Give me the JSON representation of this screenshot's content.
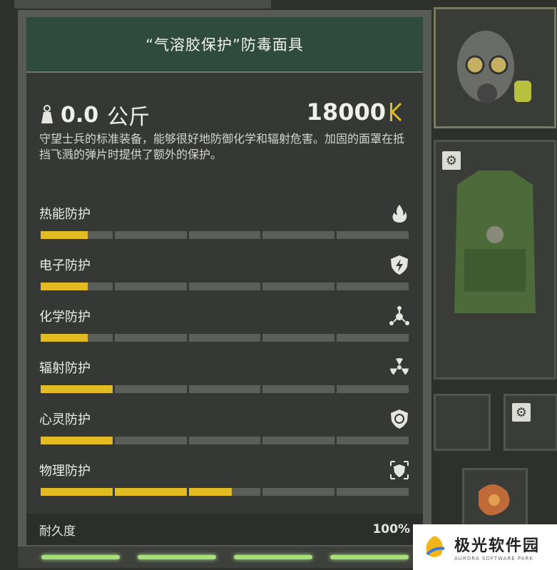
{
  "item": {
    "title": "“气溶胶保护”防毒面具",
    "weight_value": "0.0",
    "weight_unit": "公斤",
    "price": "18000",
    "description": "守望士兵的标准装备，能够很好地防御化学和辐射危害。加固的面罩在抵挡飞溅的弹片时提供了额外的保护。"
  },
  "stats": [
    {
      "label": "热能防护",
      "icon": "fire-icon",
      "level": 0.13
    },
    {
      "label": "电子防护",
      "icon": "electric-shield-icon",
      "level": 0.13
    },
    {
      "label": "化学防护",
      "icon": "chemical-icon",
      "level": 0.13
    },
    {
      "label": "辐射防护",
      "icon": "radiation-icon",
      "level": 0.2
    },
    {
      "label": "心灵防护",
      "icon": "psy-shield-icon",
      "level": 0.2
    },
    {
      "label": "物理防护",
      "icon": "physical-shield-icon",
      "level": 0.52
    }
  ],
  "durability": {
    "label": "耐久度",
    "value": "100%"
  },
  "watermark": {
    "cn": "极光软件园",
    "en": "AURORA SOFTWARE PARK"
  },
  "colors": {
    "bar_fill": "#e2bb22",
    "bar_empty": "#5c5e5a",
    "title_bg": "#2f4a3e",
    "glow": "#a6e07a"
  }
}
